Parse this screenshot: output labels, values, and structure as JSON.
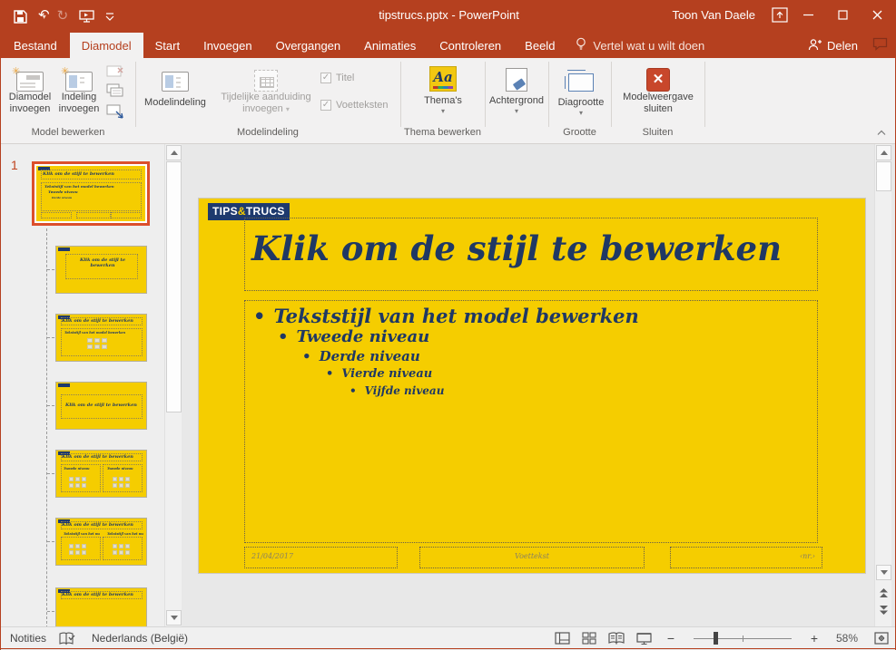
{
  "titlebar": {
    "title": "tipstrucs.pptx  -  PowerPoint",
    "user": "Toon Van Daele"
  },
  "tabs": {
    "bestand": "Bestand",
    "diamodel": "Diamodel",
    "start": "Start",
    "invoegen": "Invoegen",
    "overgangen": "Overgangen",
    "animaties": "Animaties",
    "controleren": "Controleren",
    "beeld": "Beeld",
    "tell_me": "Vertel wat u wilt doen",
    "share": "Delen"
  },
  "ribbon": {
    "insert_master": "Diamodel invoegen",
    "insert_layout": "Indeling invoegen",
    "group_edit_master": "Model bewerken",
    "master_layout_btn": "Modelindeling",
    "insert_placeholder_1": "Tijdelijke aanduiding",
    "insert_placeholder_2": "invoegen",
    "chk_title": "Titel",
    "chk_footers": "Voetteksten",
    "group_master_layout": "Modelindeling",
    "themes": "Thema's",
    "themes_icon_text": "Aa",
    "group_edit_theme": "Thema bewerken",
    "background": "Achtergrond",
    "slide_size": "Diagrootte",
    "group_size": "Grootte",
    "close_master_1": "Modelweergave",
    "close_master_2": "sluiten",
    "group_close": "Sluiten"
  },
  "panel": {
    "slide_number": "1"
  },
  "slide": {
    "logo_tips": "TIPS",
    "logo_amp": "&",
    "logo_trucs": "TRUCS",
    "title": "Klik om de stijl te bewerken",
    "bullet_dot": "•",
    "bullet1": "Tekststijl van het model bewerken",
    "bullet2": "Tweede niveau",
    "bullet3": "Derde niveau",
    "bullet4": "Vierde niveau",
    "bullet5": "Vijfde niveau",
    "footer_date": "21/04/2017",
    "footer_text": "Voettekst",
    "footer_number": "‹nr.›"
  },
  "statusbar": {
    "notes": "Notities",
    "language": "Nederlands (België)",
    "zoom_level": "58%"
  },
  "colors": {
    "titlebar_red": "#b5401f",
    "slide_yellow": "#f5cd00",
    "logo_navy": "#1e3a6e",
    "text_navy": "#1f3864",
    "selection_orange": "#dc4f2b"
  }
}
